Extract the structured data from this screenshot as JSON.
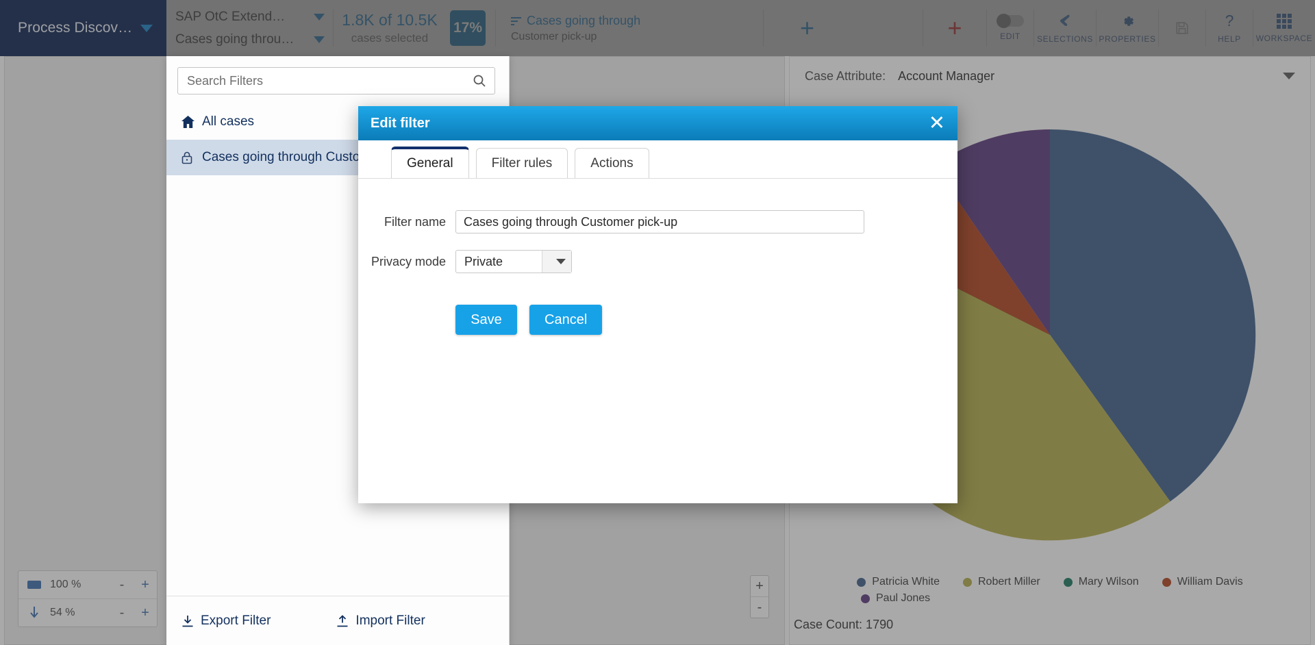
{
  "header": {
    "brand": "Process Discov…",
    "datamodel_select": "SAP OtC Extend…",
    "filter_select": "Cases going throu…",
    "counts_primary": "1.8K of 10.5K",
    "counts_secondary": "cases selected",
    "percent_badge": "17%",
    "active_filter_title": "Cases going through",
    "active_filter_sub": "Customer pick-up",
    "add_component_label": "+",
    "add_red_label": "+",
    "tools": [
      {
        "label": "EDIT",
        "icon": "toggle-switch-icon",
        "dim": false
      },
      {
        "label": "SELECTIONS",
        "icon": "pointer-hand-icon",
        "dim": false
      },
      {
        "label": "PROPERTIES",
        "icon": "gear-icon",
        "dim": false
      },
      {
        "label": "SAVE",
        "icon": "floppy-disk-icon",
        "dim": true
      },
      {
        "label": "HELP",
        "icon": "question-mark-icon",
        "dim": false
      },
      {
        "label": "WORKSPACE",
        "icon": "grid-icon",
        "dim": false
      }
    ]
  },
  "filter_panel": {
    "search_placeholder": "Search Filters",
    "search_value": "",
    "items": [
      {
        "label": "All cases",
        "icon": "home-icon",
        "selected": false
      },
      {
        "label": "Cases going through Customer pick-up",
        "icon": "lock-icon",
        "selected": true
      }
    ],
    "footer": {
      "export_label": "Export Filter",
      "import_label": "Import Filter"
    }
  },
  "modal": {
    "title": "Edit filter",
    "close_label": "✕",
    "tabs": [
      {
        "label": "General",
        "active": true
      },
      {
        "label": "Filter rules",
        "active": false
      },
      {
        "label": "Actions",
        "active": false
      }
    ],
    "fields": {
      "filter_name_label": "Filter name",
      "filter_name_value": "Cases going through Customer pick-up",
      "filter_name_placeholder": "",
      "privacy_label": "Privacy mode",
      "privacy_value": "Private"
    },
    "buttons": {
      "save": "Save",
      "cancel": "Cancel"
    }
  },
  "canvas": {
    "zoom_in": "+",
    "zoom_out": "-",
    "scale": {
      "horizontal_value": "100 %",
      "vertical_value": "54 %",
      "minus": "-",
      "plus": "+"
    }
  },
  "pie_panel": {
    "attribute_label": "Case Attribute:",
    "attribute_value": "Account Manager",
    "case_count_label": "Case Count: 1790"
  },
  "chart_data": {
    "type": "pie",
    "title": "Account Manager",
    "legend_position": "bottom",
    "categories": [
      "Patricia White",
      "Robert Miller",
      "Mary Wilson",
      "William Davis",
      "Paul Jones"
    ],
    "values": [
      36.0,
      36.5,
      7.5,
      8.0,
      12.0
    ],
    "colors": [
      "#3e5f8a",
      "#b5ae4a",
      "#18795f",
      "#b2431c",
      "#5b3a7e"
    ],
    "unit": "percent",
    "total_cases": 1790
  }
}
